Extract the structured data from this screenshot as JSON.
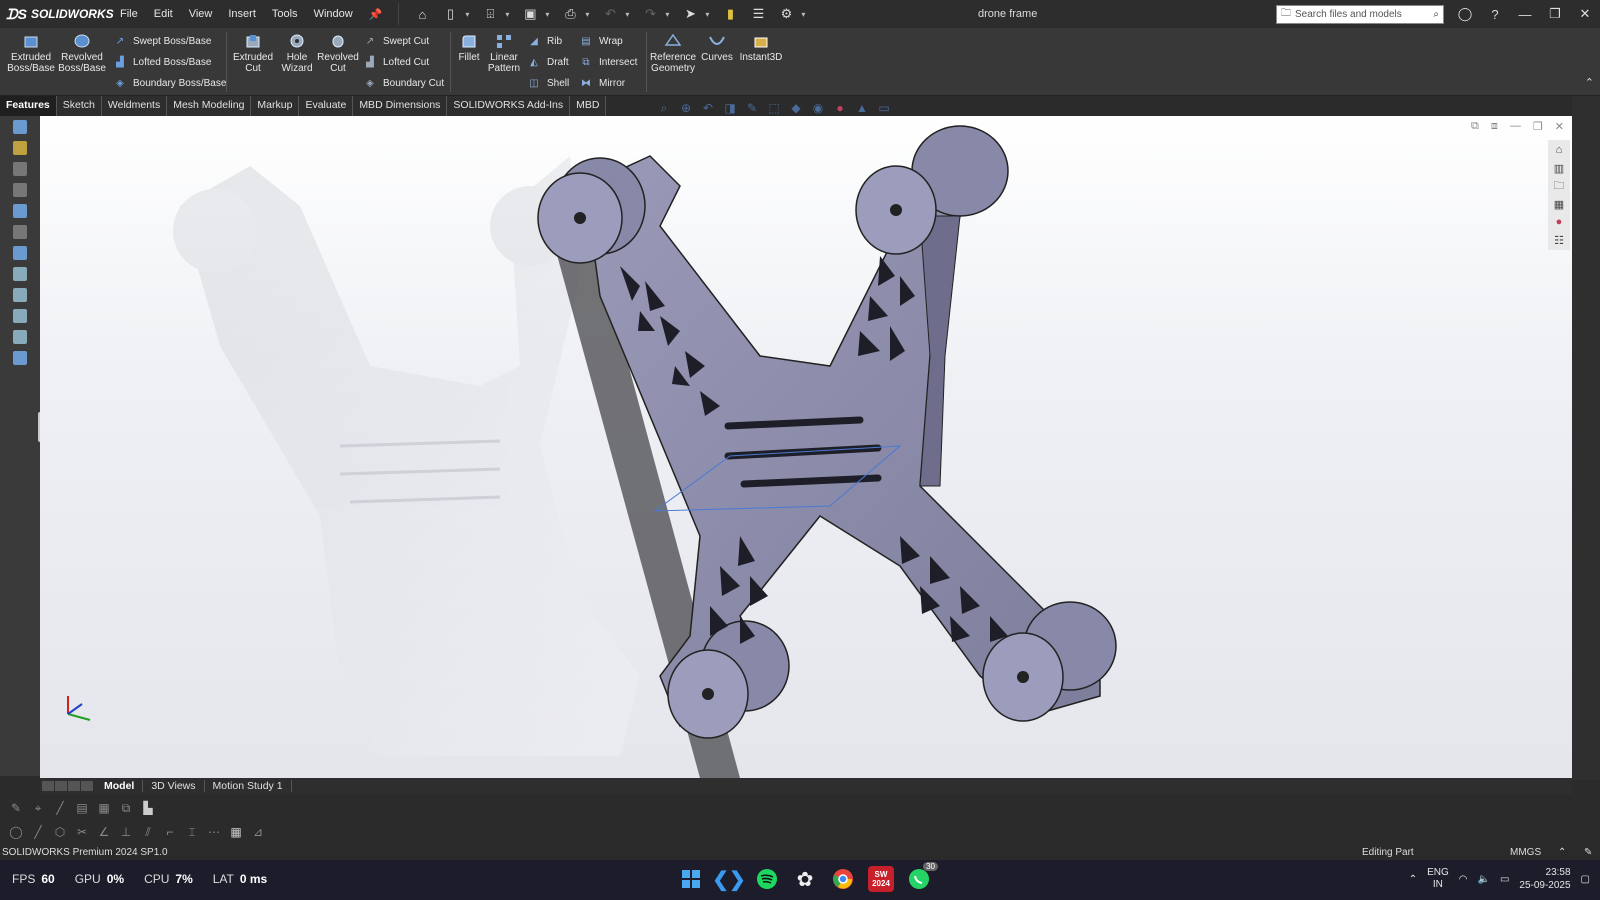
{
  "app": {
    "name": "SOLIDWORKS",
    "document_title": "drone frame"
  },
  "menu": [
    "File",
    "Edit",
    "View",
    "Insert",
    "Tools",
    "Window"
  ],
  "search": {
    "placeholder": "Search files and models"
  },
  "ribbon": {
    "extruded_boss": "Extruded Boss/Base",
    "revolved_boss": "Revolved Boss/Base",
    "swept_boss": "Swept Boss/Base",
    "lofted_boss": "Lofted Boss/Base",
    "boundary_boss": "Boundary Boss/Base",
    "extruded_cut": "Extruded Cut",
    "hole_wizard": "Hole Wizard",
    "revolved_cut": "Revolved Cut",
    "swept_cut": "Swept Cut",
    "lofted_cut": "Lofted Cut",
    "boundary_cut": "Boundary Cut",
    "fillet": "Fillet",
    "linear_pattern": "Linear Pattern",
    "rib": "Rib",
    "draft": "Draft",
    "shell": "Shell",
    "wrap": "Wrap",
    "intersect": "Intersect",
    "mirror": "Mirror",
    "reference_geometry": "Reference Geometry",
    "curves": "Curves",
    "instant3d": "Instant3D"
  },
  "tabs": [
    "Features",
    "Sketch",
    "Weldments",
    "Mesh Modeling",
    "Markup",
    "Evaluate",
    "MBD Dimensions",
    "SOLIDWORKS Add-Ins",
    "MBD"
  ],
  "bottom_tabs": [
    "Model",
    "3D Views",
    "Motion Study 1"
  ],
  "status": {
    "product": "SOLIDWORKS Premium 2024 SP1.0",
    "mode": "Editing Part",
    "units": "MMGS"
  },
  "perf": {
    "fps_label": "FPS",
    "fps": "60",
    "gpu_label": "GPU",
    "gpu": "0%",
    "cpu_label": "CPU",
    "cpu": "7%",
    "lat_label": "LAT",
    "lat": "0 ms"
  },
  "tray": {
    "lang1": "ENG",
    "lang2": "IN",
    "time": "23:58",
    "date": "25-09-2025",
    "whatsapp_badge": "30"
  },
  "colors": {
    "part": "#8c8ca8",
    "viewport_top": "#ffffff",
    "ribbon": "#383838"
  }
}
